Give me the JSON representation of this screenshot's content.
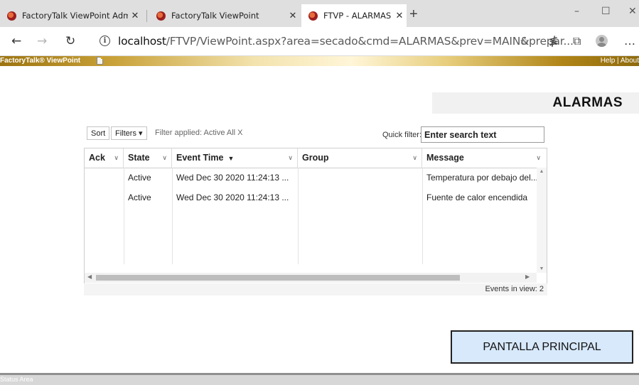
{
  "browser": {
    "tabs": [
      {
        "title": "FactoryTalk ViewPoint Administra",
        "active": false
      },
      {
        "title": "FactoryTalk ViewPoint",
        "active": false
      },
      {
        "title": "FTVP - ALARMAS",
        "active": true
      }
    ],
    "new_tab_symbol": "+",
    "window_controls": [
      "–",
      "☐",
      "✕"
    ],
    "address": {
      "host": "localhost",
      "path": "/FTVP/ViewPoint.aspx?area=secado&cmd=ALARMAS&prev=MAIN&prepar..."
    },
    "icons": [
      "back-icon",
      "forward-icon",
      "refresh-icon",
      "info-icon",
      "favorite-star-icon",
      "favorites-list-icon",
      "collections-icon",
      "profile-icon",
      "more-icon"
    ]
  },
  "viewpoint": {
    "title": "FactoryTalk® ViewPoint",
    "help_links": "Help | About"
  },
  "page": {
    "title": "ALARMAS",
    "toolbar": {
      "sort_label": "Sort",
      "filters_label": "Filters ▾",
      "filter_applied": "Filter applied: Active All X",
      "quick_filter_label": "Quick filter:",
      "quick_filter_placeholder": "Enter search text"
    },
    "columns": [
      {
        "label": "Ack"
      },
      {
        "label": "State"
      },
      {
        "label": "Event Time",
        "sort": "▼"
      },
      {
        "label": "Group"
      },
      {
        "label": "Message"
      }
    ],
    "rows": [
      {
        "ack": "",
        "state": "Active",
        "time": "Wed Dec 30 2020 11:24:13 ...",
        "group": "",
        "message": "Temperatura por debajo del..."
      },
      {
        "ack": "",
        "state": "Active",
        "time": "Wed Dec 30 2020 11:24:13 ...",
        "group": "",
        "message": "Fuente de calor encendida"
      }
    ],
    "footer": "Events in view: 2",
    "main_button": "PANTALLA PRINCIPAL"
  },
  "status_bar": "Status Area",
  "colors": {
    "button_fill": "#d7e9fb",
    "banner_gold": "#c9a23a"
  }
}
